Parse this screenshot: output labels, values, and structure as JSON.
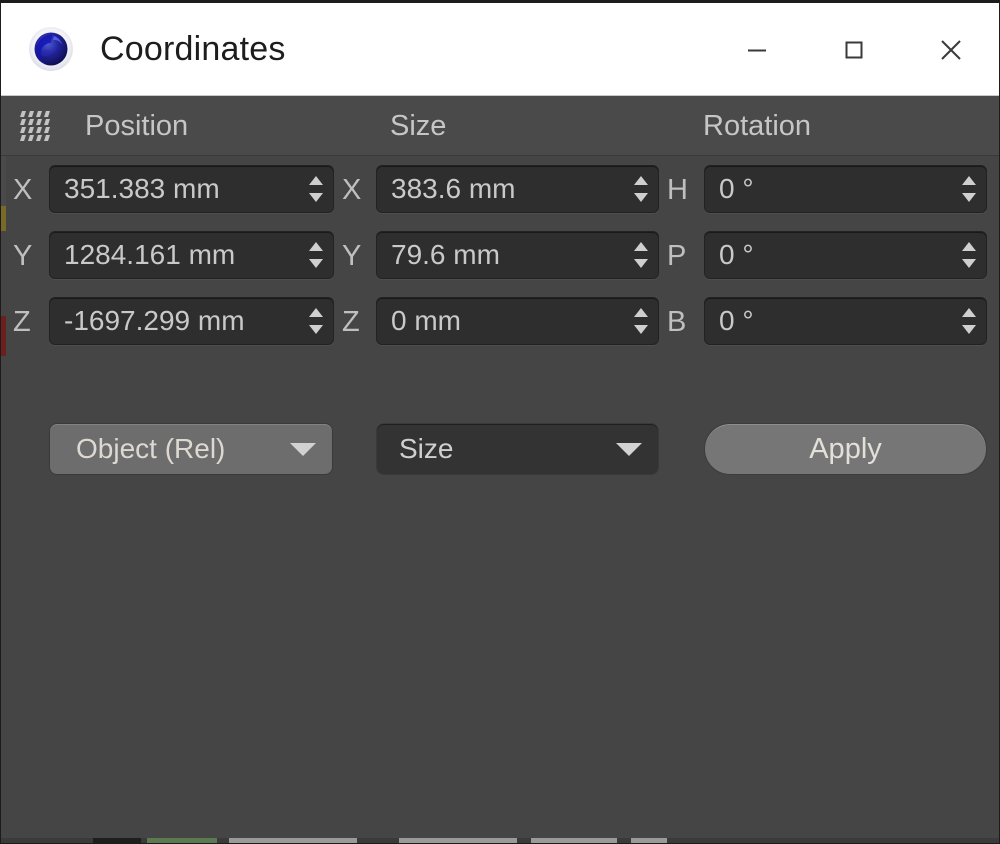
{
  "window": {
    "title": "Coordinates",
    "logo_icon": "cinema4d-logo-icon",
    "controls": {
      "minimize": "minimize-icon",
      "maximize": "maximize-icon",
      "close": "close-icon"
    }
  },
  "panel": {
    "grip_icon": "drag-grip-icon",
    "headers": {
      "position": "Position",
      "size": "Size",
      "rotation": "Rotation"
    },
    "rows": [
      {
        "position": {
          "axis": "X",
          "value": "351.383 mm"
        },
        "size": {
          "axis": "X",
          "value": "383.6 mm"
        },
        "rotation": {
          "axis": "H",
          "value": "0 °"
        }
      },
      {
        "position": {
          "axis": "Y",
          "value": "1284.161 mm"
        },
        "size": {
          "axis": "Y",
          "value": "79.6 mm"
        },
        "rotation": {
          "axis": "P",
          "value": "0 °"
        }
      },
      {
        "position": {
          "axis": "Z",
          "value": "-1697.299 mm"
        },
        "size": {
          "axis": "Z",
          "value": "0 mm"
        },
        "rotation": {
          "axis": "B",
          "value": "0 °"
        }
      }
    ],
    "controls": {
      "reference_dropdown": "Object (Rel)",
      "mode_dropdown": "Size",
      "apply_button": "Apply"
    }
  },
  "colors": {
    "titlebar_bg": "#ffffff",
    "panel_bg": "#454545",
    "header_bg": "#4a4a4a",
    "field_bg": "#2e2e2e",
    "field_text": "#c9c9c9",
    "label_text": "#bfbfbf",
    "dropdown_active_bg": "#6d6d6d",
    "dropdown_bg": "#333333",
    "apply_bg": "#767676"
  }
}
